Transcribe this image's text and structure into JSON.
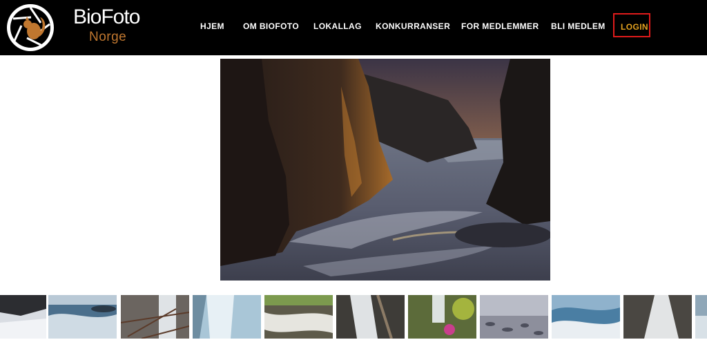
{
  "brand": {
    "name_line1": "BioFoto",
    "name_line2": "Norge",
    "logo_icon": "squirrel-aperture-icon",
    "colors": {
      "header_bg": "#000000",
      "accent_orange": "#c0772f",
      "login_text": "#e4a21f",
      "login_border": "#e01b1b"
    }
  },
  "nav": {
    "items": [
      "HJEM",
      "OM BIOFOTO",
      "LOKALLAG",
      "KONKURRANSER",
      "FOR MEDLEMMER",
      "BLI MEDLEM"
    ],
    "login": "LOGIN"
  },
  "hero": {
    "subject": "rocky coastal cliffs at sunset with long-exposure water"
  },
  "gallery": {
    "thumbnails": [
      "snowy shore",
      "waves on rocks",
      "frozen waterfall with branches",
      "icy waterfall",
      "rushing stream",
      "waterfall in forest",
      "mossy waterfall",
      "misty pebble beach",
      "snowy coastline",
      "grey waterfall",
      "partial image"
    ]
  }
}
